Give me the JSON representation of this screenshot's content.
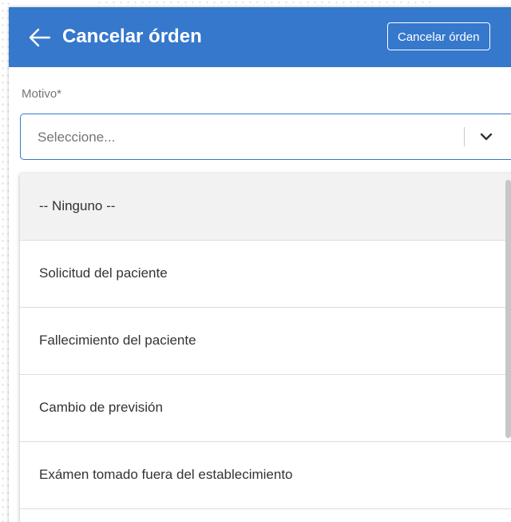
{
  "header": {
    "title": "Cancelar órden",
    "action_label": "Cancelar órden",
    "back_icon": "arrow-left-icon",
    "background_color": "#3578cc"
  },
  "form": {
    "reason_label": "Motivo*",
    "select": {
      "placeholder": "Seleccione...",
      "icon": "chevron-down-icon"
    }
  },
  "dropdown": {
    "options": [
      {
        "label": "-- Ninguno --",
        "highlighted": true
      },
      {
        "label": "Solicitud del paciente",
        "highlighted": false
      },
      {
        "label": "Fallecimiento del paciente",
        "highlighted": false
      },
      {
        "label": "Cambio de previsión",
        "highlighted": false
      },
      {
        "label": "Exámen tomado fuera del establecimiento",
        "highlighted": false
      }
    ]
  }
}
